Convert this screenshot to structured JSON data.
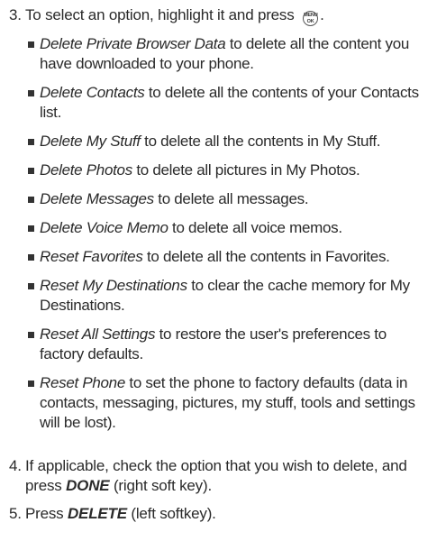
{
  "step3": {
    "number": "3.",
    "text_before": "To select an option, highlight it and press",
    "key_icon": "menu-ok-key",
    "key_top": "MENU",
    "key_bottom": "OK",
    "text_after": "."
  },
  "options": [
    {
      "name": "Delete Private Browser Data",
      "desc": " to delete all the content you have downloaded to your phone."
    },
    {
      "name": "Delete Contacts",
      "desc": " to delete all the contents of your Contacts list."
    },
    {
      "name": "Delete My Stuff",
      "desc": " to delete all the contents in My Stuff."
    },
    {
      "name": "Delete Photos",
      "desc": " to delete all pictures in My Photos."
    },
    {
      "name": "Delete Messages",
      "desc": " to delete all messages."
    },
    {
      "name": "Delete Voice Memo",
      "desc": " to delete all voice memos."
    },
    {
      "name": "Reset Favorites",
      "desc": " to delete all the contents in Favorites."
    },
    {
      "name": "Reset My Destinations",
      "desc": " to clear the cache memory for My Destinations."
    },
    {
      "name": "Reset All Settings",
      "desc": " to restore the user's preferences to factory defaults."
    },
    {
      "name": "Reset Phone",
      "desc": " to set the phone to factory defaults (data in contacts, messaging, pictures, my stuff, tools and settings will be lost)."
    }
  ],
  "step4": {
    "number": "4.",
    "text_before": "If applicable, check the option that you wish to delete, and press ",
    "key": "DONE",
    "text_after": " (right soft key)."
  },
  "step5": {
    "number": "5.",
    "text_before": "Press ",
    "key": "DELETE",
    "text_after": " (left softkey)."
  }
}
